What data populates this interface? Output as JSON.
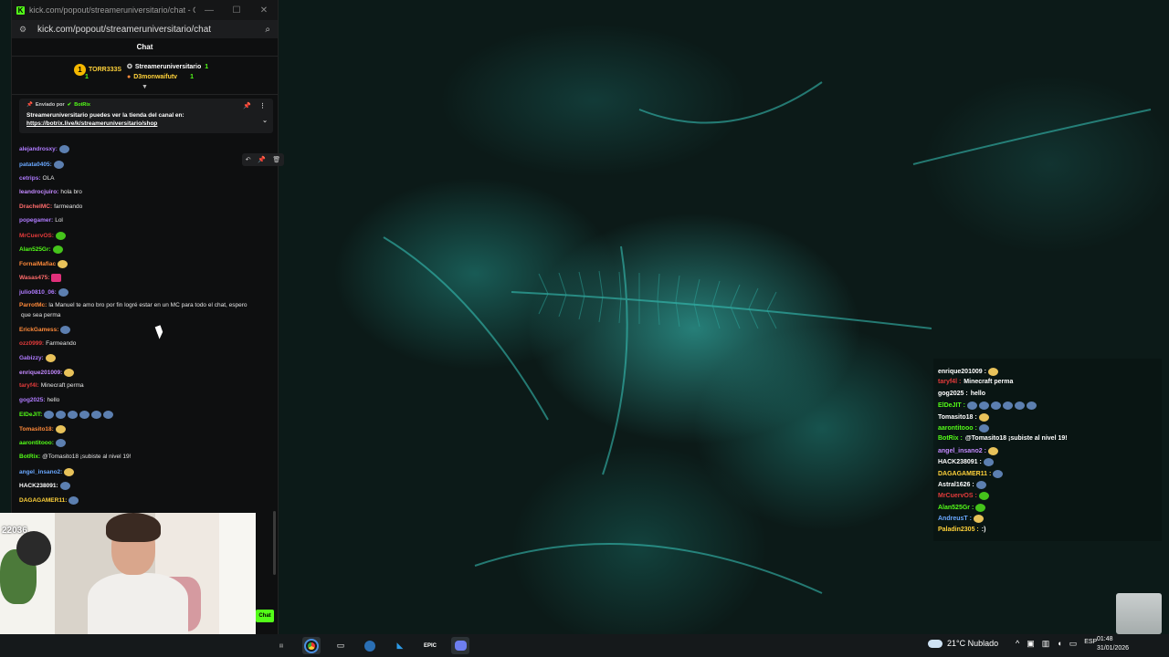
{
  "browser": {
    "title": "kick.com/popout/streameruniversitario/chat - Go...",
    "url": "kick.com/popout/streameruniversitario/chat",
    "chat_title": "Chat"
  },
  "leaderboard": {
    "first": {
      "rank": "1",
      "name": "TORR333S"
    },
    "second": {
      "name": "Streameruniversitario",
      "count": "1"
    },
    "third": {
      "count": "1"
    },
    "fourth": {
      "name": "D3monwaifutv",
      "count": "1"
    }
  },
  "pinned": {
    "sent_by": "Enviado por",
    "author": "BotRix",
    "message": "Streameruniversitario puedes ver la tienda del canal en:",
    "link": "https://botrix.live/k/streameruniversitario/shop"
  },
  "chat": [
    {
      "user": "alejandrosxy:",
      "text": "",
      "color": "#b07bff",
      "emote": "blue",
      "behind_pinned": true
    },
    {
      "user": "patata0405:",
      "text": "",
      "color": "#6aa8ff",
      "emote": "blue"
    },
    {
      "user": "cetrips:",
      "text": "OLA",
      "color": "#b07bff"
    },
    {
      "user": "leandrocjuiro:",
      "text": "hola bro",
      "color": "#c389ff"
    },
    {
      "user": "DracheIMC:",
      "text": "farmeando",
      "color": "#ff6b6b"
    },
    {
      "user": "popegamer:",
      "text": "Lol",
      "color": "#b07bff"
    },
    {
      "user": "MrCuervOS:",
      "text": "",
      "color": "#e33b3b",
      "emote": "green"
    },
    {
      "user": "Alan525Gr:",
      "text": "",
      "color": "#53fc18",
      "emote": "green"
    },
    {
      "user": "FornaiMafiac",
      "text": "",
      "color": "#ff8a3a",
      "emote": "face"
    },
    {
      "user": "Wasas475:",
      "text": "",
      "color": "#ff6b6b",
      "emote": "pink"
    },
    {
      "user": "julio0810_06:",
      "text": "",
      "color": "#b07bff",
      "emote": "blue"
    },
    {
      "user": "ParrotMc:",
      "text": "la Manuel te amo bro por fin logré estar en un MC para todo el chat, espero",
      "color": "#ff8a3a"
    },
    {
      "user": "",
      "text": "que sea perma",
      "color": "#ffffff"
    },
    {
      "user": "ErickGamess:",
      "text": "",
      "color": "#ff8a3a",
      "emote": "blue"
    },
    {
      "user": "ozz0999:",
      "text": "Farmeando",
      "color": "#e33b3b"
    },
    {
      "user": "Gabizzy:",
      "text": "",
      "color": "#b07bff",
      "emote": "face"
    },
    {
      "user": "enrique201009:",
      "text": "",
      "color": "#c389ff",
      "emote": "face"
    },
    {
      "user": "taryf4l:",
      "text": "Minecraft perma",
      "color": "#e33b3b"
    },
    {
      "user": "gog2025:",
      "text": "hello",
      "color": "#b07bff"
    },
    {
      "user": "ElDeJIT:",
      "text": "",
      "color": "#53fc18",
      "emote": "blue6"
    },
    {
      "user": "Tomasito18:",
      "text": "",
      "color": "#ff8a3a",
      "emote": "face"
    },
    {
      "user": "aarontitooo:",
      "text": "",
      "color": "#53fc18",
      "emote": "blue"
    },
    {
      "user": "BotRix:",
      "text": "@Tomasito18 ¡subiste al nivel 19!",
      "color": "#53fc18"
    },
    {
      "user": "angel_insano2:",
      "text": "",
      "color": "#6aa8ff",
      "emote": "face"
    },
    {
      "user": "HACK238091:",
      "text": "",
      "color": "#ffffff",
      "emote": "blue"
    },
    {
      "user": "DAGAGAMER11:",
      "text": "",
      "color": "#ffd23a",
      "emote": "blue"
    }
  ],
  "webcam": {
    "count": "22036",
    "chat_button": "Chat"
  },
  "overlay": [
    {
      "user": "enrique201009 :",
      "text": "",
      "color": "#ffffff",
      "emote": "face"
    },
    {
      "user": "taryf4l :",
      "text": "Minecraft perma",
      "color": "#e33b3b"
    },
    {
      "user": "gog2025 :",
      "text": "hello",
      "color": "#ffffff"
    },
    {
      "user": "ElDeJIT :",
      "text": "",
      "color": "#53fc18",
      "emote": "blue6"
    },
    {
      "user": "Tomasito18 :",
      "text": "",
      "color": "#ffffff",
      "emote": "face"
    },
    {
      "user": "aarontitooo :",
      "text": "",
      "color": "#53fc18",
      "emote": "blue"
    },
    {
      "user": "BotRix :",
      "text": "@Tomasito18 ¡subiste al nivel 19!",
      "color": "#53fc18"
    },
    {
      "user": "angel_insano2 :",
      "text": "",
      "color": "#c389ff",
      "emote": "face"
    },
    {
      "user": "HACK238091 :",
      "text": "",
      "color": "#ffffff",
      "emote": "blue"
    },
    {
      "user": "DAGAGAMER11 :",
      "text": "",
      "color": "#ffd23a",
      "emote": "blue"
    },
    {
      "user": "Astral1626 :",
      "text": "",
      "color": "#ffffff",
      "emote": "blue"
    },
    {
      "user": "MrCuervOS :",
      "text": "",
      "color": "#e33b3b",
      "emote": "green"
    },
    {
      "user": "Alan525Gr :",
      "text": "",
      "color": "#53fc18",
      "emote": "green"
    },
    {
      "user": "AndreusT :",
      "text": "",
      "color": "#6aa8ff",
      "emote": "face"
    },
    {
      "user": "Paladin2305 :",
      "text": ":)",
      "color": "#ffd23a"
    }
  ],
  "taskbar": {
    "icons": [
      "luma-icon",
      "chrome-icon",
      "clipboard-icon",
      "steam-icon",
      "vscode-icon",
      "epic-icon",
      "discord-icon"
    ],
    "epic_label": "EPIC",
    "weather": "21°C  Nublado",
    "language": "ESP",
    "time": "01:48",
    "date": "31/01/2026"
  }
}
